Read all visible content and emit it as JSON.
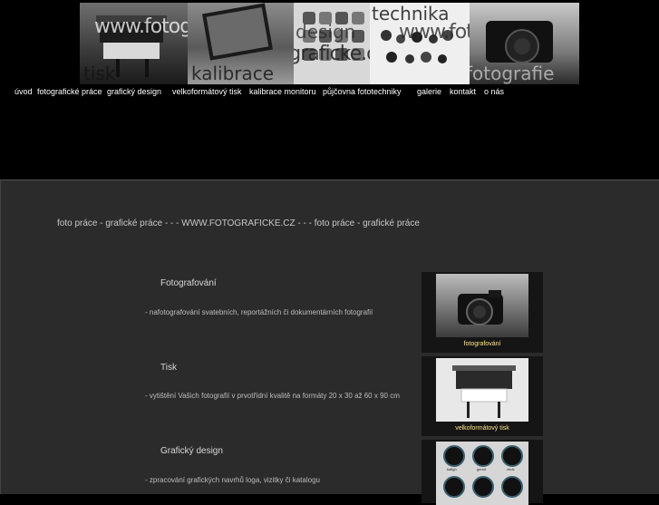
{
  "banner": {
    "watermark_1": "www.fotograficke.cz",
    "watermark_2": "www.fotograficke.cz",
    "watermark_3": "www.fotograficke.cz",
    "label_tisk": "tisk",
    "label_kalibrace": "kalibrace",
    "label_design": "design",
    "label_technika": "technika",
    "label_fotografie": "fotografie"
  },
  "nav": {
    "items": [
      {
        "label": "úvod"
      },
      {
        "label": "fotografické práce"
      },
      {
        "label": "grafický design"
      },
      {
        "label": "velkoformátový tisk"
      },
      {
        "label": "kalibrace monitoru"
      },
      {
        "label": "půjčovna fototechniky"
      },
      {
        "label": "galerie"
      },
      {
        "label": "kontakt"
      },
      {
        "label": "o nás"
      }
    ]
  },
  "main": {
    "headline": "foto práce - grafické práce - - - WWW.FOTOGRAFICKE.CZ - - - foto práce - grafické práce",
    "sections": [
      {
        "title": "Fotografování",
        "text": "- nafotografování svatebních, reportážních či dokumentárních fotografií",
        "caption": "fotografování"
      },
      {
        "title": "Tisk",
        "text": "- vytištění Vašich fotografií v prvotřídní kvalitě na formáty 20 x 30 až 60 x 90 cm",
        "caption": "velkoformátový tisk"
      },
      {
        "title": "Grafický design",
        "text": "- zpracování grafických navrhů loga, vizitky či katalogu",
        "caption": ""
      }
    ],
    "design_icon_labels": [
      "kafigh",
      "genot",
      "zhuk"
    ]
  },
  "colors": {
    "background": "#000000",
    "content_bg": "#2b2b2b",
    "caption": "#ffe58a"
  }
}
